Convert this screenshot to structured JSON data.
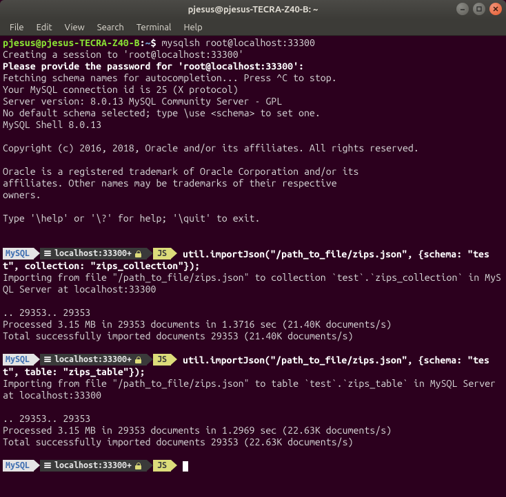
{
  "window": {
    "title": "pjesus@pjesus-TECRA-Z40-B: ~"
  },
  "menu": {
    "file": "File",
    "edit": "Edit",
    "view": "View",
    "search": "Search",
    "terminal": "Terminal",
    "help": "Help"
  },
  "shell_prompt": {
    "user_host": "pjesus@pjesus-TECRA-Z40-B",
    "cwd": "~",
    "command": "mysqlsh root@localhost:33300"
  },
  "session_output": {
    "l1": "Creating a session to 'root@localhost:33300'",
    "l2": "Please provide the password for 'root@localhost:33300':",
    "l3": "Fetching schema names for autocompletion... Press ^C to stop.",
    "l4": "Your MySQL connection id is 25 (X protocol)",
    "l5": "Server version: 8.0.13 MySQL Community Server - GPL",
    "l6": "No default schema selected; type \\use <schema> to set one.",
    "l7": "MySQL Shell 8.0.13",
    "l8": "Copyright (c) 2016, 2018, Oracle and/or its affiliates. All rights reserved.",
    "l9": "Oracle is a registered trademark of Oracle Corporation and/or its",
    "l10": "affiliates. Other names may be trademarks of their respective",
    "l11": "owners.",
    "l12": "Type '\\help' or '\\?' for help; '\\quit' to exit."
  },
  "mysql_prompt": {
    "label": "MySQL",
    "host": "localhost:33300+",
    "mode": "JS"
  },
  "blocks": [
    {
      "cmd": "util.importJson(\"/path_to_file/zips.json\", {schema: \"test\", collection: \"zips_collection\"});",
      "out1": "Importing from file \"/path_to_file/zips.json\" to collection `test`.`zips_collection` in MySQL Server at localhost:33300",
      "dots": ".. 29353.. 29353",
      "proc": "Processed 3.15 MB in 29353 documents in 1.3716 sec (21.40K documents/s)",
      "tot": "Total successfully imported documents 29353 (21.40K documents/s)"
    },
    {
      "cmd": "util.importJson(\"/path_to_file/zips.json\", {schema: \"test\", table: \"zips_table\"});",
      "out1": "Importing from file \"/path_to_file/zips.json\" to table `test`.`zips_table` in MySQL Server at localhost:33300",
      "dots": ".. 29353.. 29353",
      "proc": "Processed 3.15 MB in 29353 documents in 1.2969 sec (22.63K documents/s)",
      "tot": "Total successfully imported documents 29353 (22.63K documents/s)"
    }
  ]
}
